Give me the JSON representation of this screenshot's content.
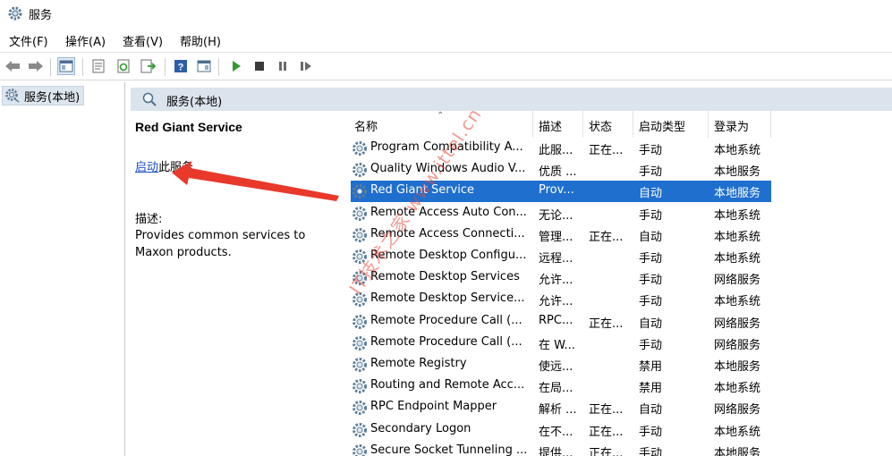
{
  "window": {
    "title": "服务"
  },
  "menu": [
    {
      "label": "文件(F)"
    },
    {
      "label": "操作(A)"
    },
    {
      "label": "查看(V)"
    },
    {
      "label": "帮助(H)"
    }
  ],
  "toolbar": {
    "buttons": [
      "back-icon",
      "forward-icon",
      "console-tree-icon",
      "properties-icon",
      "refresh-icon",
      "export-icon",
      "help-icon",
      "view-icon",
      "play-icon",
      "stop-icon",
      "pause-icon",
      "restart-icon"
    ]
  },
  "tree": {
    "root_label": "服务(本地)"
  },
  "main": {
    "header": "服务(本地)"
  },
  "details": {
    "service_name": "Red Giant Service",
    "start_link": "启动",
    "start_suffix": "此服务",
    "desc_label": "描述:",
    "desc_text": "Provides common services to Maxon products."
  },
  "table": {
    "columns": [
      "名称",
      "描述",
      "状态",
      "启动类型",
      "登录为"
    ],
    "rows": [
      {
        "name": "Program Compatibility A...",
        "desc": "此服...",
        "status": "正在...",
        "start": "手动",
        "logon": "本地系统"
      },
      {
        "name": "Quality Windows Audio V...",
        "desc": "优质 ...",
        "status": "",
        "start": "手动",
        "logon": "本地服务"
      },
      {
        "name": "Red Giant Service",
        "desc": "Prov...",
        "status": "",
        "start": "自动",
        "logon": "本地服务",
        "selected": true
      },
      {
        "name": "Remote Access Auto Con...",
        "desc": "无论...",
        "status": "",
        "start": "手动",
        "logon": "本地系统"
      },
      {
        "name": "Remote Access Connecti...",
        "desc": "管理...",
        "status": "正在...",
        "start": "自动",
        "logon": "本地系统"
      },
      {
        "name": "Remote Desktop Configu...",
        "desc": "远程...",
        "status": "",
        "start": "手动",
        "logon": "本地系统"
      },
      {
        "name": "Remote Desktop Services",
        "desc": "允许...",
        "status": "",
        "start": "手动",
        "logon": "网络服务"
      },
      {
        "name": "Remote Desktop Service...",
        "desc": "允许...",
        "status": "",
        "start": "手动",
        "logon": "本地系统"
      },
      {
        "name": "Remote Procedure Call (...",
        "desc": "RPC...",
        "status": "正在...",
        "start": "自动",
        "logon": "网络服务"
      },
      {
        "name": "Remote Procedure Call (...",
        "desc": "在 W...",
        "status": "",
        "start": "手动",
        "logon": "网络服务"
      },
      {
        "name": "Remote Registry",
        "desc": "使远...",
        "status": "",
        "start": "禁用",
        "logon": "本地服务"
      },
      {
        "name": "Routing and Remote Acc...",
        "desc": "在局...",
        "status": "",
        "start": "禁用",
        "logon": "本地系统"
      },
      {
        "name": "RPC Endpoint Mapper",
        "desc": "解析 ...",
        "status": "正在...",
        "start": "自动",
        "logon": "网络服务"
      },
      {
        "name": "Secondary Logon",
        "desc": "在不...",
        "status": "正在...",
        "start": "手动",
        "logon": "本地系统"
      },
      {
        "name": "Secure Socket Tunneling ...",
        "desc": "提供...",
        "status": "正在...",
        "start": "手动",
        "logon": "本地服务"
      }
    ]
  },
  "watermark": "IT技术之家 www.ittel.cn",
  "colors": {
    "selection": "#1f6fce",
    "link": "#1a4fc8",
    "header_band": "#dbe3ec",
    "annotation": "#e8392b"
  }
}
